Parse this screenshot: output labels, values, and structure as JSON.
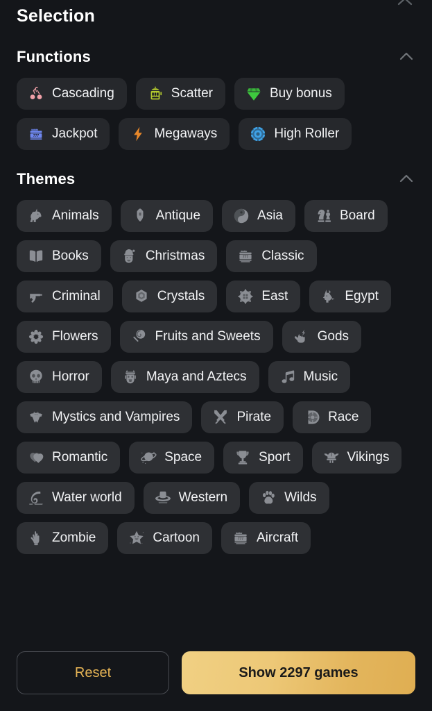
{
  "page": {
    "title": "Selection",
    "background_color": "#14161a"
  },
  "sections": [
    {
      "id": "functions",
      "title": "Functions",
      "collapse_icon": "chevron-up-icon",
      "expanded": true,
      "chips": [
        {
          "label": "Cascading",
          "icon": "cherries-icon",
          "icon_color": "#f0a0a8"
        },
        {
          "label": "Scatter",
          "icon": "slot-machine-icon",
          "icon_color": "#b5cc2e"
        },
        {
          "label": "Buy bonus",
          "icon": "gem-icon",
          "icon_color": "#3ec93e"
        },
        {
          "label": "Jackpot",
          "icon": "777-jackpot-icon",
          "icon_color": "#6f87f0"
        },
        {
          "label": "Megaways",
          "icon": "lightning-bolt-icon",
          "icon_color": "#e8882a"
        },
        {
          "label": "High Roller",
          "icon": "casino-chip-icon",
          "icon_color": "#3fa3e8"
        }
      ]
    },
    {
      "id": "themes",
      "title": "Themes",
      "collapse_icon": "chevron-up-icon",
      "expanded": true,
      "chips": [
        {
          "label": "Animals",
          "icon": "unicorn-icon"
        },
        {
          "label": "Antique",
          "icon": "spartan-helmet-icon"
        },
        {
          "label": "Asia",
          "icon": "yin-yang-icon"
        },
        {
          "label": "Board",
          "icon": "chess-pieces-icon"
        },
        {
          "label": "Books",
          "icon": "open-book-icon"
        },
        {
          "label": "Christmas",
          "icon": "santa-icon"
        },
        {
          "label": "Classic",
          "icon": "slot-777-icon"
        },
        {
          "label": "Criminal",
          "icon": "revolver-icon"
        },
        {
          "label": "Crystals",
          "icon": "crystal-gem-icon"
        },
        {
          "label": "East",
          "icon": "compass-lantern-icon"
        },
        {
          "label": "Egypt",
          "icon": "anubis-icon"
        },
        {
          "label": "Flowers",
          "icon": "cherry-blossom-icon"
        },
        {
          "label": "Fruits and Sweets",
          "icon": "lollipop-icon"
        },
        {
          "label": "Gods",
          "icon": "hand-lightning-icon"
        },
        {
          "label": "Horror",
          "icon": "skull-icon"
        },
        {
          "label": "Maya and Aztecs",
          "icon": "totem-mask-icon"
        },
        {
          "label": "Music",
          "icon": "music-notes-icon"
        },
        {
          "label": "Mystics and Vampires",
          "icon": "bat-icon"
        },
        {
          "label": "Pirate",
          "icon": "crossed-swords-icon"
        },
        {
          "label": "Race",
          "icon": "steering-wheel-icon"
        },
        {
          "label": "Romantic",
          "icon": "hearts-icon"
        },
        {
          "label": "Space",
          "icon": "planet-icon"
        },
        {
          "label": "Sport",
          "icon": "trophy-icon"
        },
        {
          "label": "Vikings",
          "icon": "viking-helmet-icon"
        },
        {
          "label": "Water world",
          "icon": "wave-icon"
        },
        {
          "label": "Western",
          "icon": "cowboy-hat-icon"
        },
        {
          "label": "Wilds",
          "icon": "paw-print-icon"
        },
        {
          "label": "Zombie",
          "icon": "zombie-hand-icon"
        },
        {
          "label": "Cartoon",
          "icon": "smiling-star-icon"
        },
        {
          "label": "Aircraft",
          "icon": "slot-777-icon"
        }
      ]
    }
  ],
  "footer": {
    "reset_label": "Reset",
    "show_label": "Show 2297 games",
    "games_count": 2297,
    "reset_color": "#e6b455",
    "show_gradient_from": "#f0d083",
    "show_gradient_to": "#dfae52"
  }
}
